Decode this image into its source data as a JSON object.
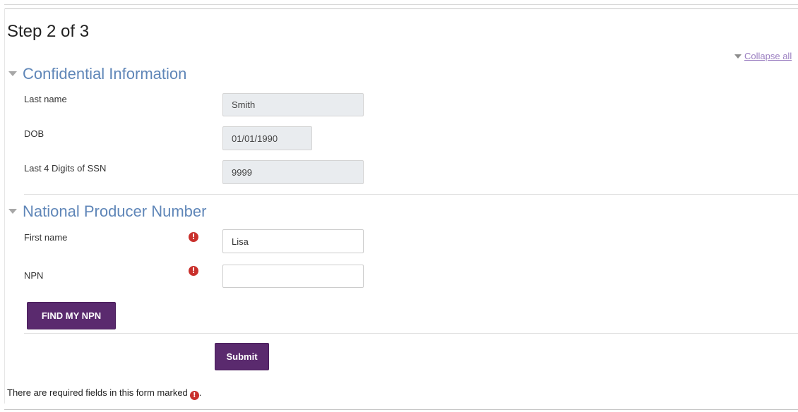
{
  "page": {
    "step_title": "Step 2 of 3",
    "collapse_all": "Collapse all"
  },
  "sections": {
    "confidential": {
      "title": "Confidential Information",
      "fields": {
        "last_name": {
          "label": "Last name",
          "value": "Smith"
        },
        "dob": {
          "label": "DOB",
          "value": "01/01/1990"
        },
        "ssn": {
          "label": "Last 4 Digits of SSN",
          "value": "9999"
        }
      }
    },
    "npn": {
      "title": "National Producer Number",
      "fields": {
        "first_name": {
          "label": "First name",
          "value": "Lisa",
          "required": true
        },
        "npn": {
          "label": "NPN",
          "value": "",
          "required": true
        }
      },
      "find_button": "FIND MY NPN"
    }
  },
  "form": {
    "submit_label": "Submit",
    "required_note": "There are required fields in this form marked",
    "required_note_end": "."
  },
  "icons": {
    "required": "exclamation-circle-icon",
    "expand": "triangle-down-icon"
  },
  "colors": {
    "accent": "#5a2a6e",
    "section_title": "#5f86b8",
    "required": "#c9302c",
    "link": "#9b7fc1"
  }
}
